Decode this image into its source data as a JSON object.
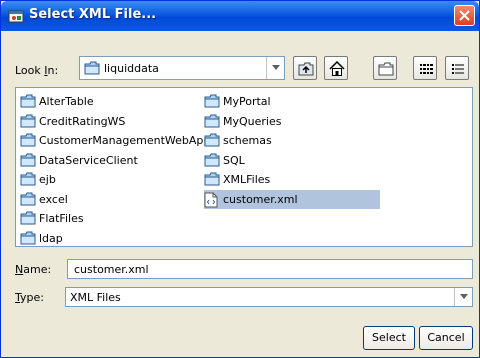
{
  "window": {
    "title": "Select XML File..."
  },
  "lookin": {
    "label_prefix": "Look ",
    "label_mnemonic": "I",
    "label_suffix": "n:",
    "value": "liquiddata"
  },
  "toolbar": {
    "up_icon": "up-one-level-icon",
    "home_icon": "home-icon",
    "new_folder_icon": "new-folder-icon",
    "list_icon": "list-view-icon",
    "details_icon": "details-view-icon"
  },
  "files": {
    "col1": [
      {
        "name": "AlterTable",
        "icon": "folder-icon"
      },
      {
        "name": "CreditRatingWS",
        "icon": "folder-icon"
      },
      {
        "name": "CustomerManagementWebApp",
        "icon": "folder-icon"
      },
      {
        "name": "DataServiceClient",
        "icon": "folder-icon"
      },
      {
        "name": "ejb",
        "icon": "folder-icon"
      },
      {
        "name": "excel",
        "icon": "folder-icon"
      },
      {
        "name": "FlatFiles",
        "icon": "folder-icon"
      },
      {
        "name": "ldap",
        "icon": "folder-icon"
      }
    ],
    "col2": [
      {
        "name": "MyPortal",
        "icon": "folder-icon"
      },
      {
        "name": "MyQueries",
        "icon": "folder-icon"
      },
      {
        "name": "schemas",
        "icon": "folder-icon"
      },
      {
        "name": "SQL",
        "icon": "folder-icon"
      },
      {
        "name": "XMLFiles",
        "icon": "folder-icon"
      },
      {
        "name": "customer.xml",
        "icon": "xml-file-icon",
        "selected": true
      }
    ]
  },
  "name_field": {
    "label_mnemonic": "N",
    "label_suffix": "ame:",
    "value": "customer.xml"
  },
  "type_field": {
    "label_mnemonic": "T",
    "label_suffix": "ype:",
    "value": "XML Files"
  },
  "buttons": {
    "select": "Select",
    "cancel": "Cancel"
  },
  "colors": {
    "title_bar": "#0a5ae0",
    "dialog_bg": "#ece9d8",
    "selection": "#b0c4de",
    "close_button": "#d9401f"
  }
}
